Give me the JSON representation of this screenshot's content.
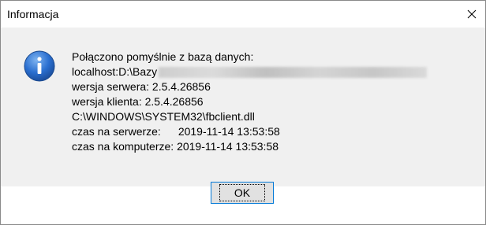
{
  "dialog": {
    "title": "Informacja",
    "close_label": "✕"
  },
  "message": {
    "line1": "Połączono pomyślnie z bazą danych:",
    "line2_prefix": "localhost:D:\\Bazy",
    "line3": "wersja serwera: 2.5.4.26856",
    "line4": "wersja klienta: 2.5.4.26856",
    "line5": "C:\\WINDOWS\\SYSTEM32\\fbclient.dll",
    "server_time_label": "czas na serwerze:",
    "server_time_value": "2019-11-14 13:53:58",
    "client_time_label": "czas na komputerze:",
    "client_time_value": "2019-11-14 13:53:58"
  },
  "buttons": {
    "ok_label": "OK"
  },
  "icons": {
    "info": "info-icon",
    "close": "close-icon"
  },
  "colors": {
    "info_icon": "#1c5fb5",
    "focus_border": "#0078d7",
    "content_bg": "#f0f0f0"
  }
}
